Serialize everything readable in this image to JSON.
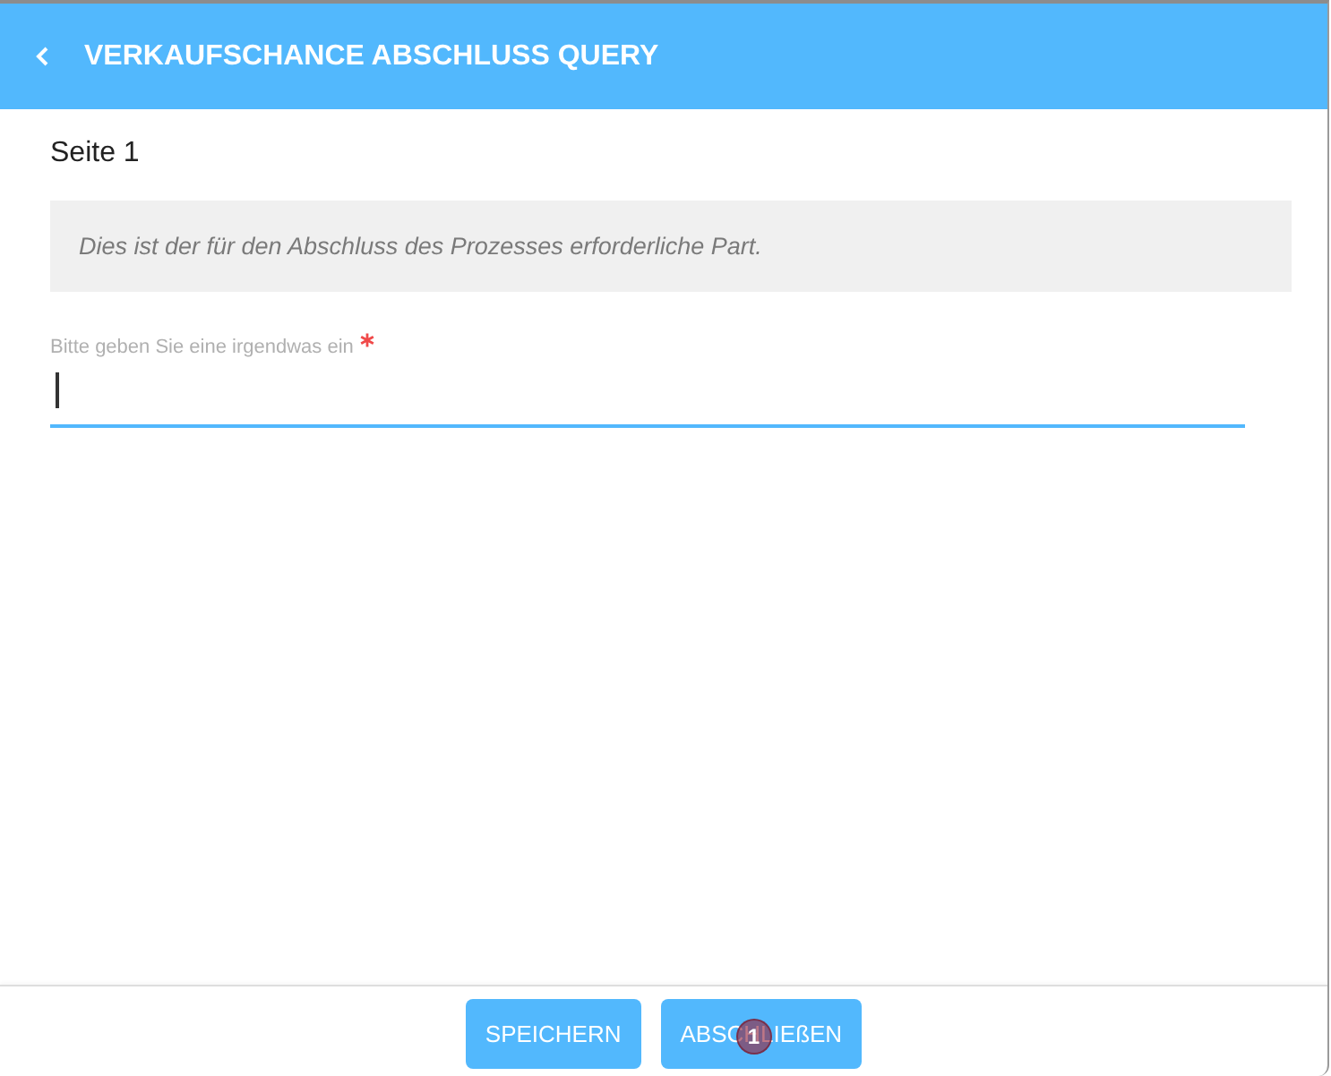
{
  "window": {
    "title": "VERKAUFSCHANCE ABSCHLUSS QUERY",
    "back_button": true
  },
  "page": {
    "heading": "Seite 1",
    "info": "Dies ist der für den Abschluss des Prozesses erforderliche Part."
  },
  "field": {
    "label": "Bitte geben Sie eine irgendwas ein",
    "required": true,
    "focused": true
  },
  "buttons": [
    {
      "label": "SPEICHERN"
    },
    {
      "label": "ABSCHLIEßEN",
      "step_marker": "1"
    }
  ]
}
